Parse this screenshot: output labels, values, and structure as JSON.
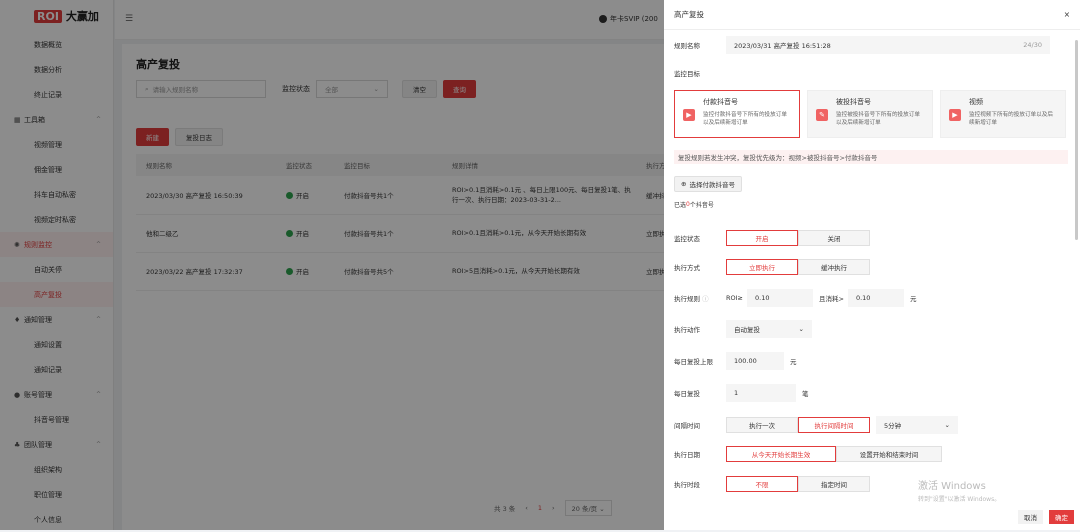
{
  "app": {
    "logo_mark": "ROI",
    "logo_text": "大赢加",
    "vip": "年卡SVIP (200"
  },
  "sidebar": {
    "items": [
      {
        "label": "数据概览",
        "type": "item"
      },
      {
        "label": "数据分析",
        "type": "item"
      },
      {
        "label": "终止记录",
        "type": "item"
      },
      {
        "label": "工具箱",
        "type": "group",
        "icon": "toolbox-icon",
        "glyph": "▦"
      },
      {
        "label": "视频管理",
        "type": "item"
      },
      {
        "label": "佣金管理",
        "type": "item"
      },
      {
        "label": "抖车自动私密",
        "type": "item"
      },
      {
        "label": "视频定时私密",
        "type": "item"
      },
      {
        "label": "规则监控",
        "type": "group",
        "icon": "monitor-icon",
        "glyph": "✺",
        "active": true
      },
      {
        "label": "自动关停",
        "type": "item"
      },
      {
        "label": "高产复投",
        "type": "item",
        "active": true
      },
      {
        "label": "通知管理",
        "type": "group",
        "icon": "bell-icon",
        "glyph": "♦"
      },
      {
        "label": "通知设置",
        "type": "item"
      },
      {
        "label": "通知记录",
        "type": "item"
      },
      {
        "label": "账号管理",
        "type": "group",
        "icon": "user-icon",
        "glyph": "●"
      },
      {
        "label": "抖音号管理",
        "type": "item"
      },
      {
        "label": "团队管理",
        "type": "group",
        "icon": "team-icon",
        "glyph": "♣"
      },
      {
        "label": "组织架构",
        "type": "item"
      },
      {
        "label": "职位管理",
        "type": "item"
      },
      {
        "label": "个人信息",
        "type": "item"
      }
    ]
  },
  "main": {
    "title": "高产复投",
    "search_placeholder": "请输入规则名称",
    "status_label": "监控状态",
    "status_value": "全部",
    "clear": "清空",
    "query": "查询",
    "new": "新建",
    "log": "复投日志",
    "columns": [
      "规则名称",
      "监控状态",
      "监控目标",
      "规则详情",
      "执行方"
    ],
    "rows": [
      {
        "name": "2023/03/30 高产复投 16:50:39",
        "status": "开启",
        "target": "付款抖音号共1个",
        "detail": "ROI>0.1且消耗>0.1元 、每日上限100元、每日复投1笔、执行一次、执行日期：2023-03-31-2...",
        "exec": "缓冲抖"
      },
      {
        "name": "他和二级乙",
        "status": "开启",
        "target": "付款抖音号共1个",
        "detail": "ROI>0.1且消耗>0.1元，从今天开始长期有效",
        "exec": "立即执"
      },
      {
        "name": "2023/03/22 高产复投 17:32:37",
        "status": "开启",
        "target": "付款抖音号共5个",
        "detail": "ROI>5且消耗>0.1元，从今天开始长期有效",
        "exec": "立即执"
      }
    ],
    "pager": {
      "total": "共 3 条",
      "prev": "‹",
      "page": "1",
      "next": "›",
      "size": "20 条/页 ⌄"
    }
  },
  "drawer": {
    "title": "高产复投",
    "close": "×",
    "name_label": "规则名称",
    "name_value": "2023/03/31 高产复投 16:51:28",
    "name_count": "24/30",
    "target_label": "监控目标",
    "cards": [
      {
        "title": "付款抖音号",
        "desc": "监控付款抖音号下所有的投放订单以及后续新增订单"
      },
      {
        "title": "被投抖音号",
        "desc": "监控被投抖音号下所有的投放订单以及后续新增订单"
      },
      {
        "title": "视频",
        "desc": "监控视频下所有的投放订单以及后续新增订单"
      }
    ],
    "notice": "复投规则若发生冲突，复投优先级为：视频>被投抖音号>付款抖音号",
    "select_btn": "选择付款抖音号",
    "selected_pre": "已选",
    "selected_num": "0",
    "selected_post": "个抖音号",
    "status_label": "监控状态",
    "status_on": "开启",
    "status_off": "关闭",
    "exec_label": "执行方式",
    "exec_now": "立即执行",
    "exec_buf": "缓冲执行",
    "rule_label": "执行规则",
    "rule_roi": "ROI≥",
    "rule_roi_val": "0.10",
    "rule_cost": "且消耗>",
    "rule_cost_val": "0.10",
    "rule_unit": "元",
    "action_label": "执行动作",
    "action_val": "自动复投",
    "limit_label": "每日复投上限",
    "limit_val": "100.00",
    "limit_unit": "元",
    "daily_label": "每日复投",
    "daily_val": "1",
    "daily_unit": "笔",
    "interval_label": "间隔时间",
    "interval_once": "执行一次",
    "interval_gap": "执行间隔时间",
    "interval_val": "5分钟",
    "date_label": "执行日期",
    "date_long": "从今天开始长期生效",
    "date_range": "设置开始和结束时间",
    "period_label": "执行时段",
    "period_any": "不限",
    "period_set": "指定时间",
    "cancel": "取消",
    "ok": "确定"
  },
  "watermark": {
    "line1": "激活 Windows",
    "line2": "转到\"设置\"以激活 Windows。"
  }
}
